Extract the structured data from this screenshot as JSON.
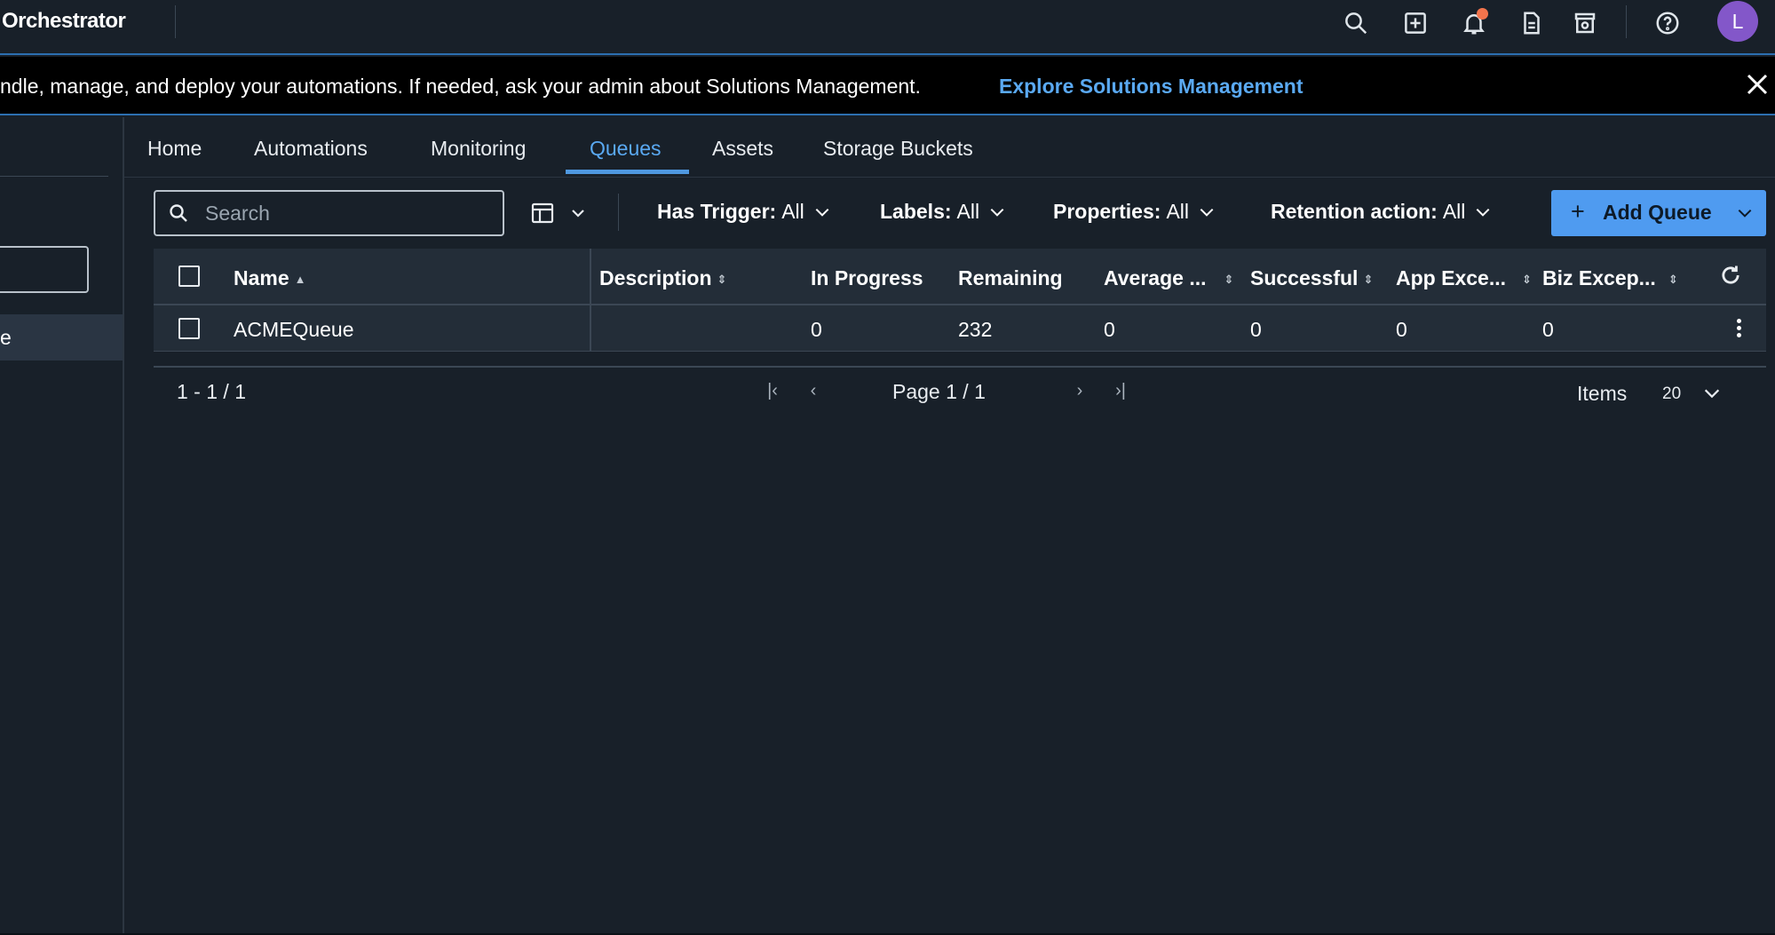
{
  "header": {
    "brand": "Orchestrator",
    "avatar_initial": "L",
    "icons": [
      "search-icon",
      "add-square-icon",
      "bell-icon",
      "document-icon",
      "store-icon",
      "help-icon"
    ],
    "notification_dot_color": "#f2744c",
    "avatar_color": "#8357c9"
  },
  "banner": {
    "text": "ndle, manage, and deploy your automations. If needed, ask your admin about Solutions Management.",
    "link": "Explore Solutions Management"
  },
  "sidebar": {
    "selected_item_label": "e"
  },
  "tabs": [
    {
      "label": "Home"
    },
    {
      "label": "Automations"
    },
    {
      "label": "Monitoring"
    },
    {
      "label": "Queues",
      "active": true
    },
    {
      "label": "Assets"
    },
    {
      "label": "Storage Buckets"
    }
  ],
  "toolbar": {
    "search_placeholder": "Search",
    "filters": [
      {
        "label": "Has Trigger:",
        "value": "All"
      },
      {
        "label": "Labels:",
        "value": "All"
      },
      {
        "label": "Properties:",
        "value": "All"
      },
      {
        "label": "Retention action:",
        "value": "All"
      }
    ],
    "add_button": "Add Queue",
    "accent_color": "#4f9bf0"
  },
  "table": {
    "columns": [
      "Name",
      "Description",
      "In Progress",
      "Remaining",
      "Average ...",
      "Successful",
      "App Exce...",
      "Biz Excep..."
    ],
    "rows": [
      {
        "name": "ACMEQueue",
        "description": "",
        "in_progress": "0",
        "remaining": "232",
        "average": "0",
        "successful": "0",
        "app_exceptions": "0",
        "biz_exceptions": "0"
      }
    ]
  },
  "pagination": {
    "range": "1 - 1 / 1",
    "page": "Page 1 / 1",
    "items_label": "Items",
    "page_size": "20"
  }
}
